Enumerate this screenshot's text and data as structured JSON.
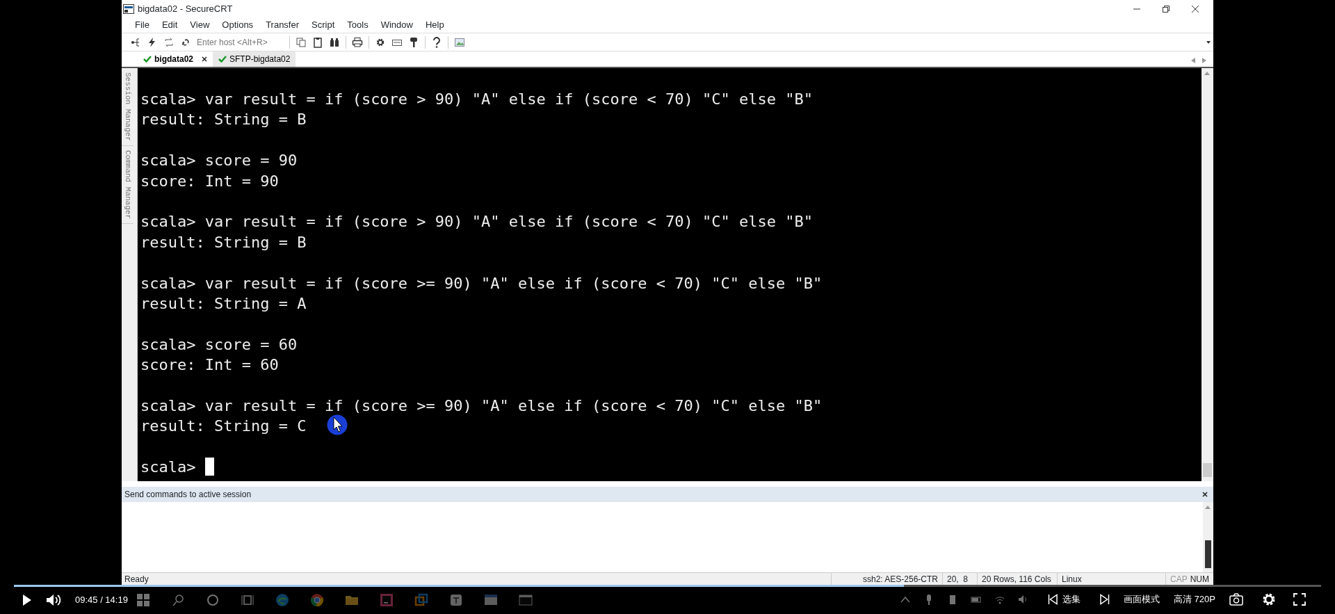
{
  "window": {
    "title": "bigdata02 - SecureCRT"
  },
  "menu": [
    "File",
    "Edit",
    "View",
    "Options",
    "Transfer",
    "Script",
    "Tools",
    "Window",
    "Help"
  ],
  "toolbar": {
    "host_placeholder": "Enter host <Alt+R>"
  },
  "side_tabs": [
    "Session Manager",
    "Command Manager"
  ],
  "tabs": [
    {
      "label": "bigdata02",
      "selected": true,
      "closable": true
    },
    {
      "label": "SFTP-bigdata02",
      "selected": false,
      "closable": false
    }
  ],
  "terminal": {
    "entries": [
      {
        "input": "scala> var result = if (score > 90) \"A\" else if (score < 70) \"C\" else \"B\"",
        "output": "result: String = B"
      },
      {
        "input": "scala> score = 90",
        "output": "score: Int = 90"
      },
      {
        "input": "scala> var result = if (score > 90) \"A\" else if (score < 70) \"C\" else \"B\"",
        "output": "result: String = B"
      },
      {
        "input": "scala> var result = if (score >= 90) \"A\" else if (score < 70) \"C\" else \"B\"",
        "output": "result: String = A"
      },
      {
        "input": "scala> score = 60",
        "output": "score: Int = 60"
      },
      {
        "input": "scala> var result = if (score >= 90) \"A\" else if (score < 70) \"C\" else \"B\"",
        "output": "result: String = C"
      },
      {
        "input": "scala>",
        "cursor": true
      }
    ]
  },
  "command_pane": {
    "title": "Send commands to active session"
  },
  "status_bar": {
    "status": "Ready",
    "cells": [
      "ssh2: AES-256-CTR",
      "20,  8",
      "20 Rows, 116 Cols",
      "Linux"
    ],
    "locks": [
      {
        "label": "CAP",
        "on": false
      },
      {
        "label": "NUM",
        "on": true
      }
    ]
  },
  "player": {
    "level": 0.681,
    "time": "09:45 / 14:19",
    "episodes": "选集",
    "mode": "画面模式",
    "quality": "高清 720P"
  }
}
